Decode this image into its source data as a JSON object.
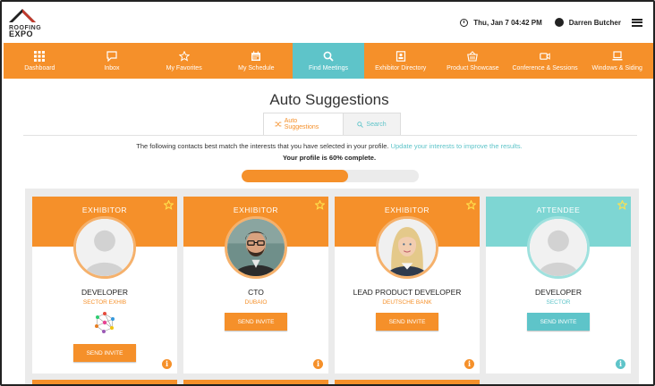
{
  "header": {
    "logo_line1": "ROOFING",
    "logo_line2": "EXPO",
    "datetime": "Thu, Jan 7 04:42 PM",
    "user_name": "Darren Butcher"
  },
  "nav": [
    {
      "label": "Dashboard",
      "icon": "grid-icon",
      "active": false
    },
    {
      "label": "Inbox",
      "icon": "message-icon",
      "active": false
    },
    {
      "label": "My Favorites",
      "icon": "star-icon",
      "active": false
    },
    {
      "label": "My Schedule",
      "icon": "calendar-icon",
      "active": false
    },
    {
      "label": "Find Meetings",
      "icon": "search-icon",
      "active": true
    },
    {
      "label": "Exhibitor Directory",
      "icon": "directory-icon",
      "active": false
    },
    {
      "label": "Product Showcase",
      "icon": "basket-icon",
      "active": false
    },
    {
      "label": "Conference & Sessions",
      "icon": "video-icon",
      "active": false
    },
    {
      "label": "Windows & Siding",
      "icon": "laptop-icon",
      "active": false
    }
  ],
  "page": {
    "title": "Auto Suggestions",
    "tabs": [
      {
        "label": "Auto Suggestions",
        "active": true
      },
      {
        "label": "Search",
        "active": false
      }
    ],
    "intro_text": "The following contacts best match the interests that you have selected in your profile.",
    "intro_link": "Update your interests to improve the results.",
    "profile_complete_text": "Your profile is 60% complete.",
    "profile_complete_fraction": 0.6
  },
  "cards": [
    {
      "type": "EXHIBITOR",
      "role": "DEVELOPER",
      "org": "SECTOR EXHIB",
      "button": "SEND INVITE",
      "avatar": "placeholder-avatar",
      "has_network_icon": true
    },
    {
      "type": "EXHIBITOR",
      "role": "CTO",
      "org": "DUBAIO",
      "button": "SEND INVITE",
      "avatar": "man-photo",
      "has_network_icon": false
    },
    {
      "type": "EXHIBITOR",
      "role": "LEAD PRODUCT DEVELOPER",
      "org": "DEUTSCHE BANK",
      "button": "SEND INVITE",
      "avatar": "woman-photo",
      "has_network_icon": false
    },
    {
      "type": "ATTENDEE",
      "role": "DEVELOPER",
      "org": "SECTOR",
      "button": "SEND INVITE",
      "avatar": "placeholder-avatar",
      "has_network_icon": false
    }
  ],
  "colors": {
    "accent_orange": "#f5902a",
    "accent_teal": "#5ec4c9"
  }
}
